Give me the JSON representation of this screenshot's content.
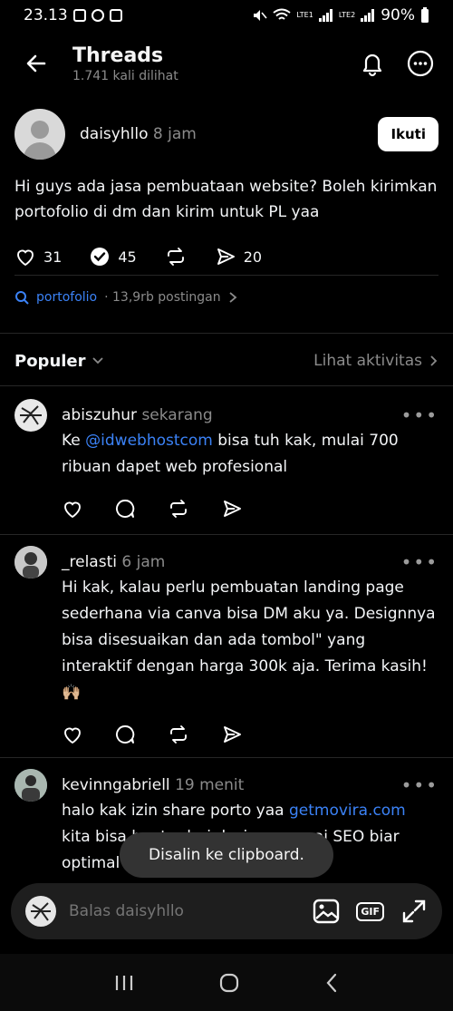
{
  "status": {
    "time": "23.13",
    "battery": "90%",
    "lte1": "LTE1",
    "lte2": "LTE2",
    "volte": "VoLTE"
  },
  "header": {
    "title": "Threads",
    "subtitle": "1.741 kali dilihat"
  },
  "post": {
    "username": "daisyhllo",
    "time": "8 jam",
    "follow": "Ikuti",
    "text": "Hi guys ada jasa pembuataan website? Boleh kirimkan portofolio di dm dan kirim untuk PL yaa",
    "likes": "31",
    "comments": "45",
    "shares": "20"
  },
  "topic": {
    "tag": "portofolio",
    "count": "· 13,9rb postingan"
  },
  "filter": {
    "label": "Populer",
    "activity": "Lihat aktivitas"
  },
  "replies": [
    {
      "user": "abiszuhur",
      "time": "sekarang",
      "pre": "Ke ",
      "mention": "@idwebhostcom",
      "text": " bisa tuh kak, mulai 700 ribuan dapet web profesional"
    },
    {
      "user": "_relasti",
      "time": "6 jam",
      "text": "Hi kak, kalau perlu pembuatan landing page sederhana via canva bisa DM aku ya. Designnya bisa disesuaikan dan ada tombol\" yang interaktif dengan harga 300k aja. Terima kasih! 🙌🏼"
    },
    {
      "user": "kevinngabriell",
      "time": "19 menit",
      "pre": "halo kak izin share porto yaa ",
      "mention": "getmovira.com",
      "text": " kita bisa bantu dari design sampai SEO biar optimal hehehe"
    }
  ],
  "toast": "Disalin ke clipboard.",
  "composer": {
    "placeholder": "Balas daisyhllo",
    "gif": "GIF"
  },
  "colors": {
    "accent": "#3b82f6",
    "background": "#000000"
  }
}
